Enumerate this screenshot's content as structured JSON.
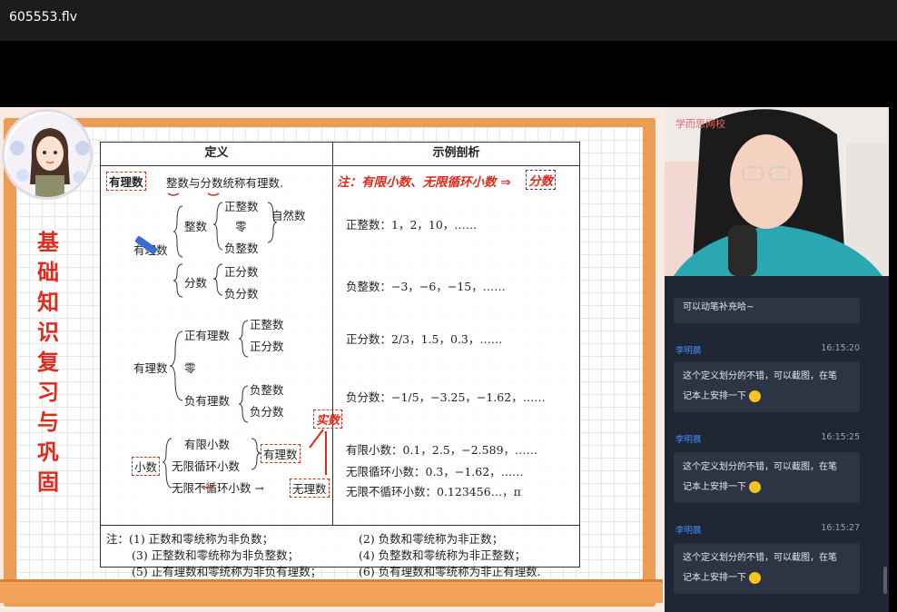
{
  "window": {
    "title": "605553.flv"
  },
  "slide": {
    "vertical_title": [
      "基",
      "础",
      "知",
      "识",
      "复",
      "习",
      "与",
      "巩",
      "固"
    ],
    "table": {
      "head_def": "定义",
      "head_ex": "示例剖析",
      "youlishu_box": "有理数",
      "def_line": "整数与分数统称有理数.",
      "handnote": "注：有限小数、无限循环小数 ⇒",
      "handbox": "分数",
      "zhengshu": "整数",
      "zhengzhengshu": "正整数",
      "ling": "零",
      "fuzhengshu": "负整数",
      "ziranshu": "自然数",
      "youlishu_left": "有理数",
      "fenshu": "分数",
      "zhengfenshu": "正分数",
      "fufenshu": "负分数",
      "ex1": "正整数：1，2，10，……",
      "ex2": "负整数：−3，−6，−15，……",
      "youlishu2": "有理数",
      "zhengyoulishu": "正有理数",
      "zhengzhengshu2": "正整数",
      "zhengfenshu2": "正分数",
      "ling2": "零",
      "fuyoulishu": "负有理数",
      "fuzhengshu2": "负整数",
      "fufenshu2": "负分数",
      "ex3": "正分数：2/3，1.5，0.3̇，……",
      "ex4": "负分数：−1/5，−3.25，−1.62̇，……",
      "shishu": "实数",
      "xiaoshu": "小数",
      "youxian": "有限小数",
      "wuxianxunhuan": "无限循环小数",
      "wuxianbuxunhuan": "无限不循环小数 →",
      "youlishu3": "有理数",
      "wulishu": "无理数",
      "ex5": "有限小数：0.1，2.5，−2.589，……",
      "ex6": "无限循环小数：0.3̇，−1.62̇，……",
      "ex7": "无限不循环小数：0.123456…，π",
      "notes": [
        "注：(1) 正数和零统称为非负数；",
        "(2) 负数和零统称为非正数；",
        "(3) 正整数和零统称为非负整数；",
        "(4) 负整数和零统称为非正整数；",
        "(5) 正有理数和零统称为非负有理数；",
        "(6) 负有理数和零统称为非正有理数."
      ]
    }
  },
  "camera": {
    "watermark": "学而思网校"
  },
  "chat": {
    "first_tail": "可以动笔补充哈~",
    "messages": [
      {
        "user": "李明晨",
        "time": "16:15:20",
        "text1": "这个定义划分的不错，可以截图，在笔",
        "text2": "记本上安排一下"
      },
      {
        "user": "李明晨",
        "time": "16:15:25",
        "text1": "这个定义划分的不错，可以截图，在笔",
        "text2": "记本上安排一下"
      },
      {
        "user": "李明晨",
        "time": "16:15:27",
        "text1": "这个定义划分的不错，可以截图，在笔",
        "text2": "记本上安排一下"
      }
    ]
  },
  "colors": {
    "accent_red": "#e02a1c",
    "board": "#ec9d55",
    "chat_bg": "#202734",
    "username": "#4c8ef2"
  }
}
